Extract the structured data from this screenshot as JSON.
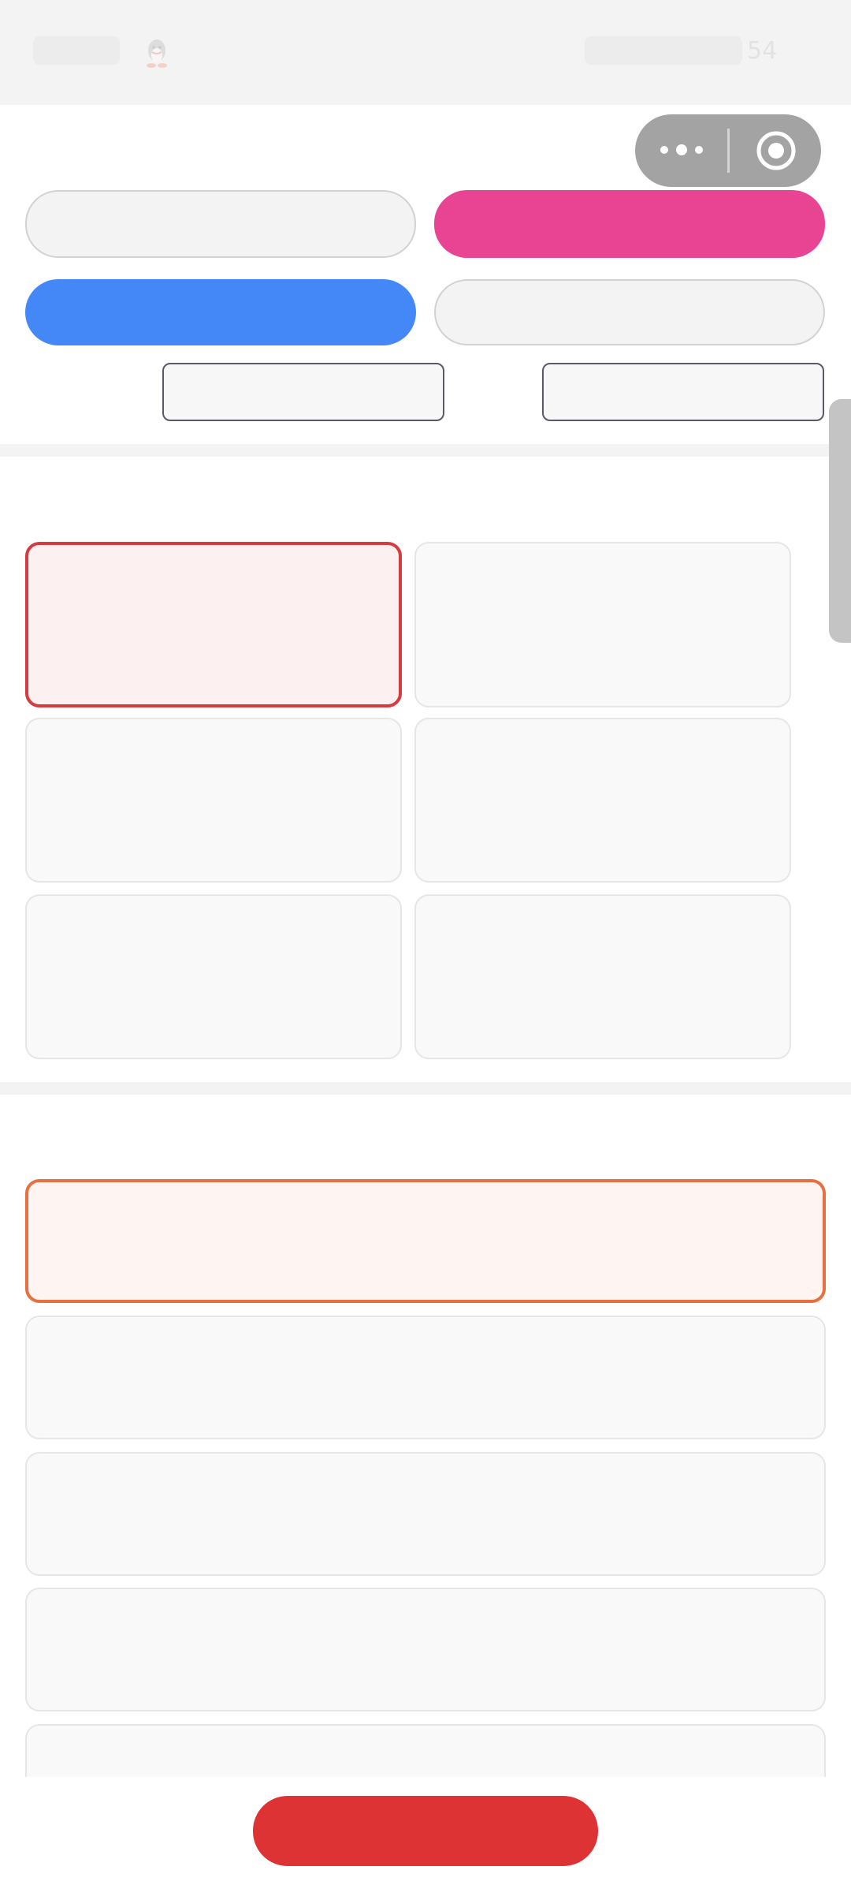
{
  "status_bar": {
    "icon": "qq-penguin-icon",
    "battery_text": "54"
  },
  "capsule": {
    "more_icon": "more-dots-icon",
    "close_icon": "target-circle-icon"
  },
  "buttons": {
    "option_a": "",
    "option_b": "",
    "option_c": "",
    "option_d": "",
    "option_e": "",
    "option_f": "",
    "submit": ""
  },
  "grid_cards": [
    "",
    "",
    "",
    "",
    "",
    ""
  ],
  "list_cards": [
    "",
    "",
    "",
    "",
    ""
  ],
  "colors": {
    "pink": "#e94393",
    "blue": "#4388f6",
    "red": "#de3334",
    "selected_red_border": "#d63b3d",
    "selected_orange_border": "#e86f3f",
    "capsule_grey": "#a3a3a3"
  }
}
